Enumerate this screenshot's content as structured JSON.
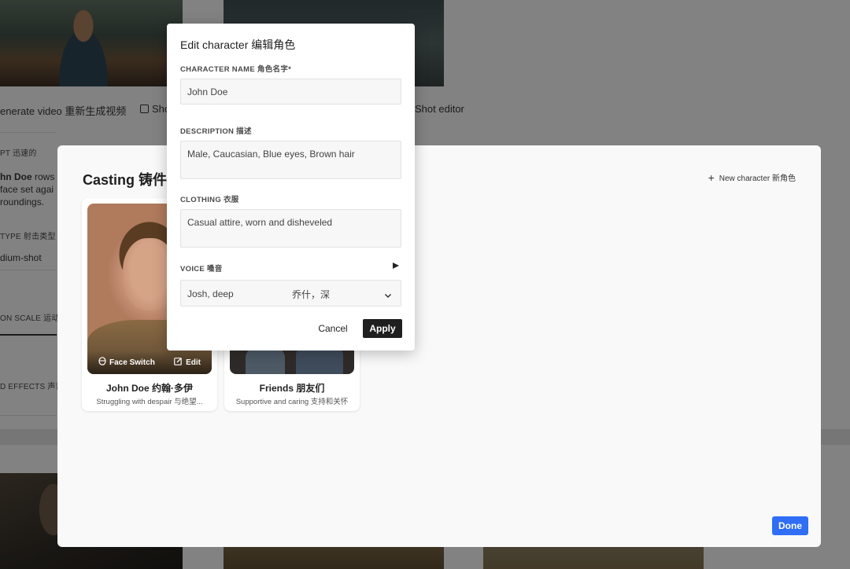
{
  "background": {
    "actions": [
      {
        "label": "enerate video  重新生成视频"
      },
      {
        "label": "Sho"
      },
      {
        "label": "Shot editor"
      }
    ],
    "prompt_label": "PT 迅速的",
    "prompt_text_line1_name": "hn Doe",
    "prompt_text_line1_rest": " rows",
    "prompt_text_line2": "face set agai",
    "prompt_text_line3": "roundings.",
    "shot_type_label": "TYPE 射击类型",
    "shot_type_value": "dium-shot",
    "motion_scale_label": "ON SCALE 运动",
    "sound_effects_label": "D EFFECTS 声音"
  },
  "casting": {
    "title": "Casting 铸件",
    "new_character_label": "New character  新角色",
    "done_label": "Done",
    "characters": [
      {
        "name": "John Doe 约翰·多伊",
        "description": "Struggling with despair 与绝望...",
        "face_switch_label": "Face Switch",
        "edit_label": "Edit"
      },
      {
        "name": "Friends 朋友们",
        "description": "Supportive and caring 支持和关怀"
      }
    ]
  },
  "edit_dialog": {
    "title": "Edit character 编辑角色",
    "name_label": "CHARACTER NAME 角色名字*",
    "name_value": "John Doe",
    "description_label": "DESCRIPTION 描述",
    "description_value": "Male, Caucasian, Blue eyes, Brown hair",
    "clothing_label": "CLOTHING 衣服",
    "clothing_value": "Casual attire, worn and disheveled",
    "voice_label": "VOICE 嗓音",
    "voice_value": "Josh, deep",
    "voice_value_cn": "乔什，深",
    "cancel_label": "Cancel",
    "apply_label": "Apply"
  },
  "colors": {
    "primary_button": "#2f6ef5",
    "apply_button": "#1f1f1f"
  }
}
